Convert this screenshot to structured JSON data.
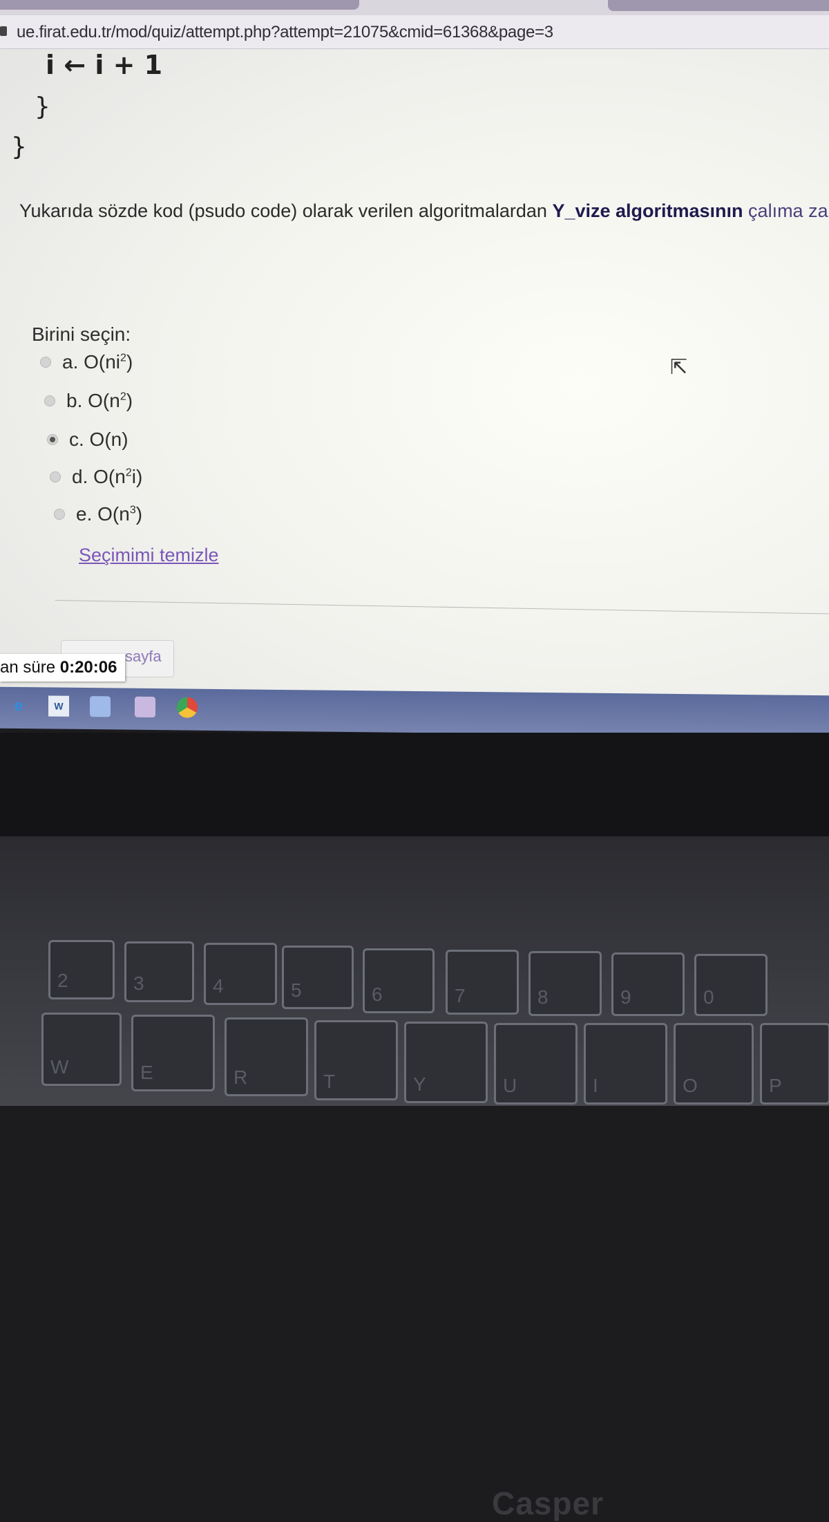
{
  "browser": {
    "url": "ue.firat.edu.tr/mod/quiz/attempt.php?attempt=21075&cmid=61368&page=3"
  },
  "code": {
    "line1": "i ← i + 1",
    "line2": "}",
    "line3": "}"
  },
  "question": {
    "text_before": "Yukarıda sözde kod (psudo code) olarak verilen algoritmalardan ",
    "bold": "Y_vize algoritmasının",
    "text_after": " çalıma zam"
  },
  "prompt": "Birini seçin:",
  "options": [
    {
      "label": "a. O(ni",
      "sup": "2",
      "tail": ")",
      "selected": false
    },
    {
      "label": "b. O(n",
      "sup": "2",
      "tail": ")",
      "selected": false
    },
    {
      "label": "c. O(n)",
      "sup": "",
      "tail": "",
      "selected": true
    },
    {
      "label": "d. O(n",
      "sup": "2",
      "tail": "i)",
      "selected": false
    },
    {
      "label": "e. O(n",
      "sup": "3",
      "tail": ")",
      "selected": false
    }
  ],
  "clear_choice": "Seçimimi temizle",
  "page_button": "sayfa",
  "timer": {
    "label": "an süre",
    "value": "0:20:06"
  },
  "laptop": {
    "brand": "Casper"
  },
  "keyboard_labels": [
    "2",
    "3",
    "4",
    "5",
    "6",
    "7",
    "8",
    "9",
    "0",
    "W",
    "E",
    "R",
    "T",
    "Y",
    "U",
    "I",
    "O",
    "P"
  ]
}
